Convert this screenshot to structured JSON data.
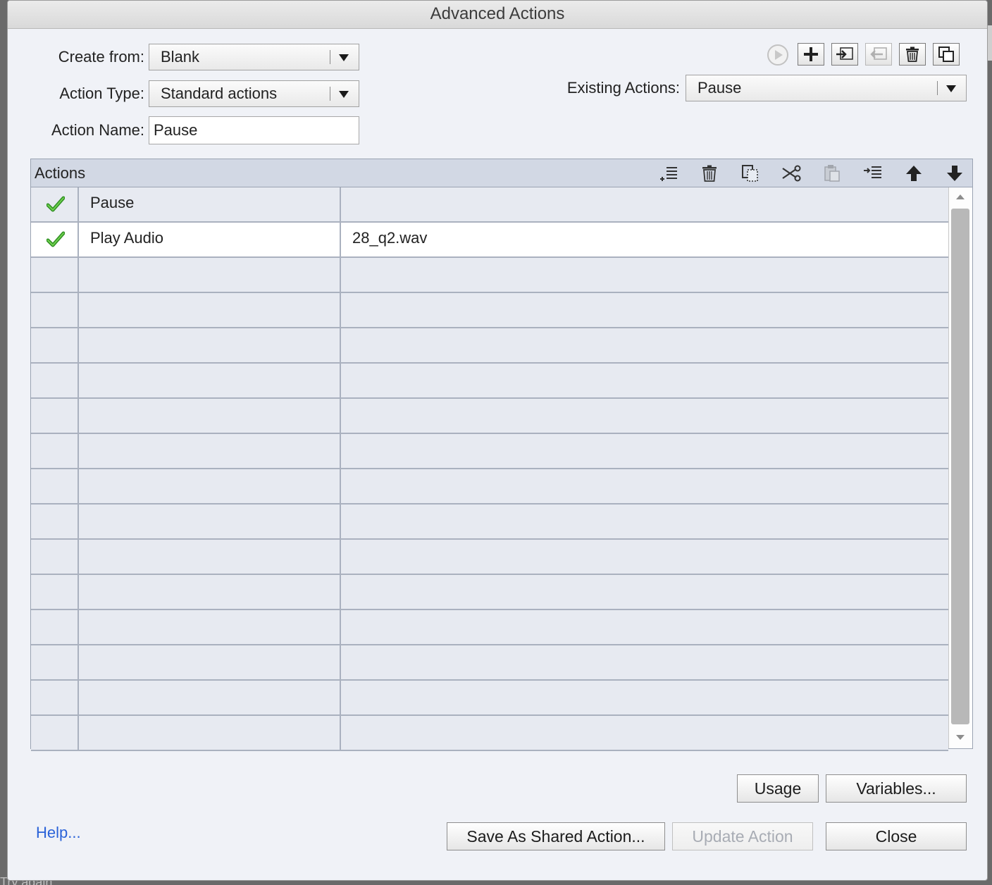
{
  "window": {
    "title": "Advanced Actions"
  },
  "form": {
    "create_from": {
      "label": "Create from:",
      "value": "Blank"
    },
    "action_type": {
      "label": "Action Type:",
      "value": "Standard actions"
    },
    "action_name": {
      "label": "Action Name:",
      "value": "Pause"
    },
    "existing_actions": {
      "label": "Existing Actions:",
      "value": "Pause"
    }
  },
  "toolbar_icons": [
    "preview-icon",
    "add-action-icon",
    "import-icon",
    "export-icon",
    "delete-icon",
    "duplicate-icon"
  ],
  "actions_table": {
    "title": "Actions",
    "header_icons": [
      "insert-row-icon",
      "delete-row-icon",
      "copy-icon",
      "cut-icon",
      "paste-icon",
      "indent-icon",
      "move-up-icon",
      "move-down-icon"
    ],
    "rows": [
      {
        "checked": true,
        "action": "Pause",
        "target": ""
      },
      {
        "checked": true,
        "action": "Play Audio",
        "target": "28_q2.wav"
      }
    ],
    "empty_rows": 14
  },
  "buttons": {
    "usage": "Usage",
    "variables": "Variables...",
    "save_shared": "Save As Shared Action...",
    "update": "Update Action",
    "close": "Close"
  },
  "help_link": "Help...",
  "background_text": "Try again",
  "colors": {
    "check": "#3aa62a",
    "link": "#2a62d8",
    "dialog_bg": "#f0f2f7"
  }
}
